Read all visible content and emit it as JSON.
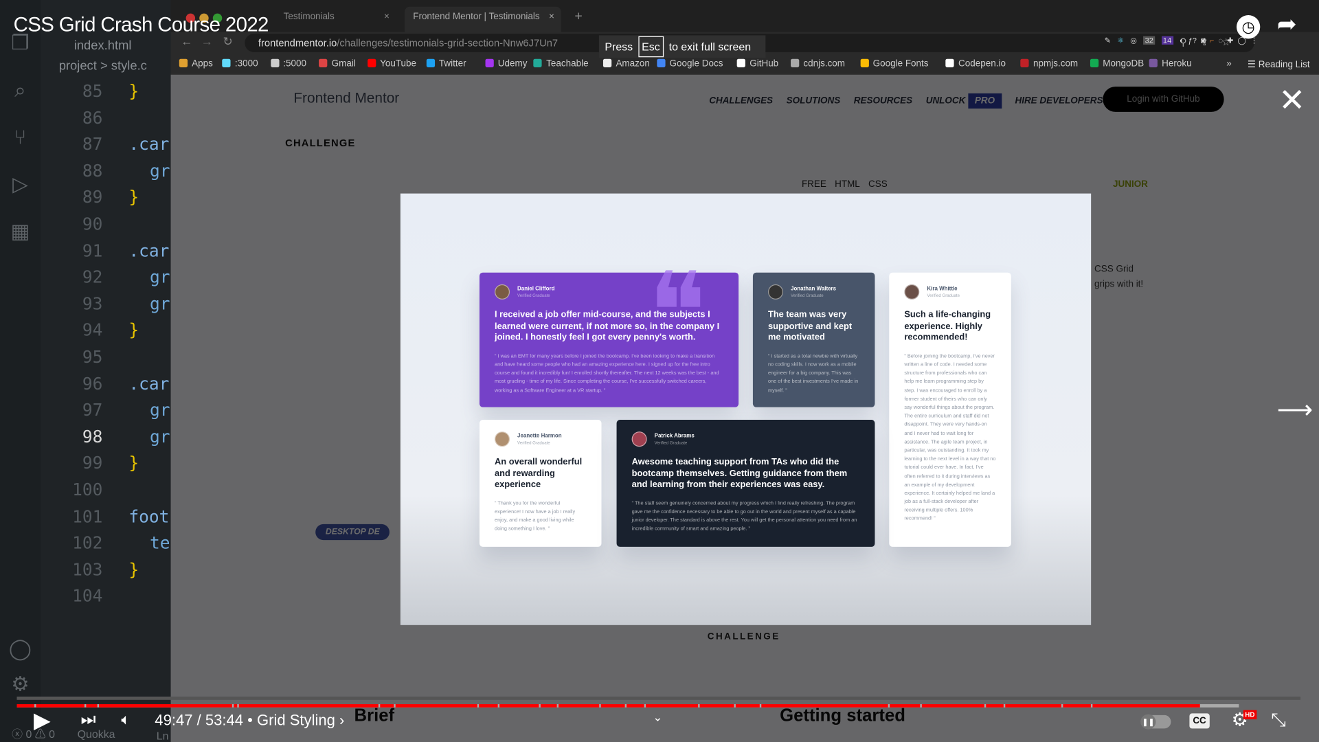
{
  "video": {
    "title": "CSS Grid Crash Course 2022",
    "time": "49:47 / 53:44",
    "chapter": "• Grid Styling ›",
    "progress_pct": 92.3,
    "buffered_pct": 95.2,
    "chapter_marks_pct": [
      1.5,
      5.4,
      6.4,
      16.9,
      17.3,
      28.3,
      29.5,
      36,
      37.6,
      40.8,
      42.2,
      45.5,
      47.5,
      49,
      53.2,
      56,
      58,
      68,
      70.5,
      75.5,
      77,
      81.5,
      83.8,
      92.3
    ],
    "cc": "CC",
    "hd": "HD"
  },
  "fullscreen_hint": {
    "press": "Press",
    "key": "Esc",
    "rest": "to exit full screen"
  },
  "editor": {
    "tab": "index.html",
    "breadcrumb": [
      "project",
      ">",
      "style.c"
    ],
    "lines": [
      "85",
      "86",
      "87",
      "88",
      "89",
      "90",
      "91",
      "92",
      "93",
      "94",
      "95",
      "96",
      "97",
      "98",
      "99",
      "100",
      "101",
      "102",
      "103",
      "104"
    ],
    "current_line": "98",
    "code": [
      {
        "n": "85",
        "t": "}",
        "k": "y"
      },
      {
        "n": "87",
        "t": ".car",
        "k": "s"
      },
      {
        "n": "88",
        "t": "gr",
        "k": "i"
      },
      {
        "n": "89",
        "t": "}",
        "k": "y"
      },
      {
        "n": "91",
        "t": ".car",
        "k": "s"
      },
      {
        "n": "92",
        "t": "gr",
        "k": "i"
      },
      {
        "n": "93",
        "t": "gr",
        "k": "i"
      },
      {
        "n": "94",
        "t": "}",
        "k": "y"
      },
      {
        "n": "96",
        "t": ".car",
        "k": "s"
      },
      {
        "n": "97",
        "t": "gr",
        "k": "i"
      },
      {
        "n": "98",
        "t": "gr",
        "k": "i"
      },
      {
        "n": "99",
        "t": "}",
        "k": "y"
      },
      {
        "n": "101",
        "t": "foot",
        "k": "s"
      },
      {
        "n": "102",
        "t": "te",
        "k": "i"
      },
      {
        "n": "103",
        "t": "}",
        "k": "y"
      }
    ],
    "status": {
      "errors": "0",
      "warnings": "0",
      "ext": "Quokka",
      "ln": "Ln"
    }
  },
  "browser": {
    "tabs": [
      {
        "label": "Testimonials"
      },
      {
        "label": "Frontend Mentor | Testimonials"
      }
    ],
    "url_host": "frontendmentor.io",
    "url_path": "/challenges/testimonials-grid-section-Nnw6J7Un7",
    "bookmarks": [
      {
        "label": "Apps",
        "c": "#e0a030"
      },
      {
        "label": ":3000",
        "c": "#61dafb"
      },
      {
        "label": ":5000",
        "c": "#ccc"
      },
      {
        "label": "Gmail",
        "c": "#d44"
      },
      {
        "label": "YouTube",
        "c": "#f00"
      },
      {
        "label": "Twitter",
        "c": "#1da1f2"
      },
      {
        "label": "Udemy",
        "c": "#a435f0"
      },
      {
        "label": "Teachable",
        "c": "#2a9"
      },
      {
        "label": "Amazon",
        "c": "#eee"
      },
      {
        "label": "Google Docs",
        "c": "#4285f4"
      },
      {
        "label": "GitHub",
        "c": "#fff"
      },
      {
        "label": "cdnjs.com",
        "c": "#aaa"
      },
      {
        "label": "Google Fonts",
        "c": "#fbbc05"
      },
      {
        "label": "Codepen.io",
        "c": "#fff"
      },
      {
        "label": "npmjs.com",
        "c": "#c12127"
      },
      {
        "label": "MongoDB",
        "c": "#13aa52"
      },
      {
        "label": "Heroku",
        "c": "#79589f"
      }
    ],
    "reading_list": "Reading List",
    "ext_badges": [
      "32",
      "14"
    ]
  },
  "site": {
    "logo": "Frontend Mentor",
    "nav": [
      "CHALLENGES",
      "SOLUTIONS",
      "RESOURCES",
      "UNLOCK"
    ],
    "pro": "PRO",
    "hire": "HIRE DEVELOPERS",
    "login": "Login with GitHub",
    "crumb": "CHALLENGE",
    "tags": [
      "FREE",
      "HTML",
      "CSS"
    ],
    "level": "JUNIOR",
    "side_text": [
      "CSS Grid",
      "grips with it!"
    ],
    "desktop": "DESKTOP DE",
    "caption": "CHALLENGE",
    "brief": "Brief",
    "getting_started": "Getting started"
  },
  "testimonials": [
    {
      "name": "Daniel Clifford",
      "role": "Verified Graduate",
      "headline": "I received a job offer mid-course, and the subjects I learned were current, if not more so, in the company I joined. I honestly feel I got every penny's worth.",
      "body": "“ I was an EMT for many years before I joined the bootcamp. I've been looking to make a transition and have heard some people who had an amazing experience here. I signed up for the free intro course and found it incredibly fun! I enrolled shortly thereafter. The next 12 weeks was the best - and most grueling - time of my life. Since completing the course, I've successfully switched careers, working as a Software Engineer at a VR startup. ”"
    },
    {
      "name": "Jonathan Walters",
      "role": "Verified Graduate",
      "headline": "The team was very supportive and kept me motivated",
      "body": "“ I started as a total newbie with virtually no coding skills. I now work as a mobile engineer for a big company. This was one of the best investments I've made in myself. ”"
    },
    {
      "name": "Kira Whittle",
      "role": "Verified Graduate",
      "headline": "Such a life-changing experience. Highly recommended!",
      "body": "“ Before joining the bootcamp, I've never written a line of code. I needed some structure from professionals who can help me learn programming step by step. I was encouraged to enroll by a former student of theirs who can only say wonderful things about the program. The entire curriculum and staff did not disappoint. They were very hands-on and I never had to wait long for assistance. The agile team project, in particular, was outstanding. It took my learning to the next level in a way that no tutorial could ever have. In fact, I've often referred to it during interviews as an example of my development experience. It certainly helped me land a job as a full-stack developer after receiving multiple offers. 100% recommend! ”"
    },
    {
      "name": "Jeanette Harmon",
      "role": "Verified Graduate",
      "headline": "An overall wonderful and rewarding experience",
      "body": "“ Thank you for the wonderful experience! I now have a job I really enjoy, and make a good living while doing something I love. ”"
    },
    {
      "name": "Patrick Abrams",
      "role": "Verified Graduate",
      "headline": "Awesome teaching support from TAs who did the bootcamp themselves. Getting guidance from them and learning from their experiences was easy.",
      "body": "“ The staff seem genuinely concerned about my progress which I find really refreshing. The program gave me the confidence necessary to be able to go out in the world and present myself as a capable junior developer. The standard is above the rest. You will get the personal attention you need from an incredible community of smart and amazing people. ”"
    }
  ]
}
